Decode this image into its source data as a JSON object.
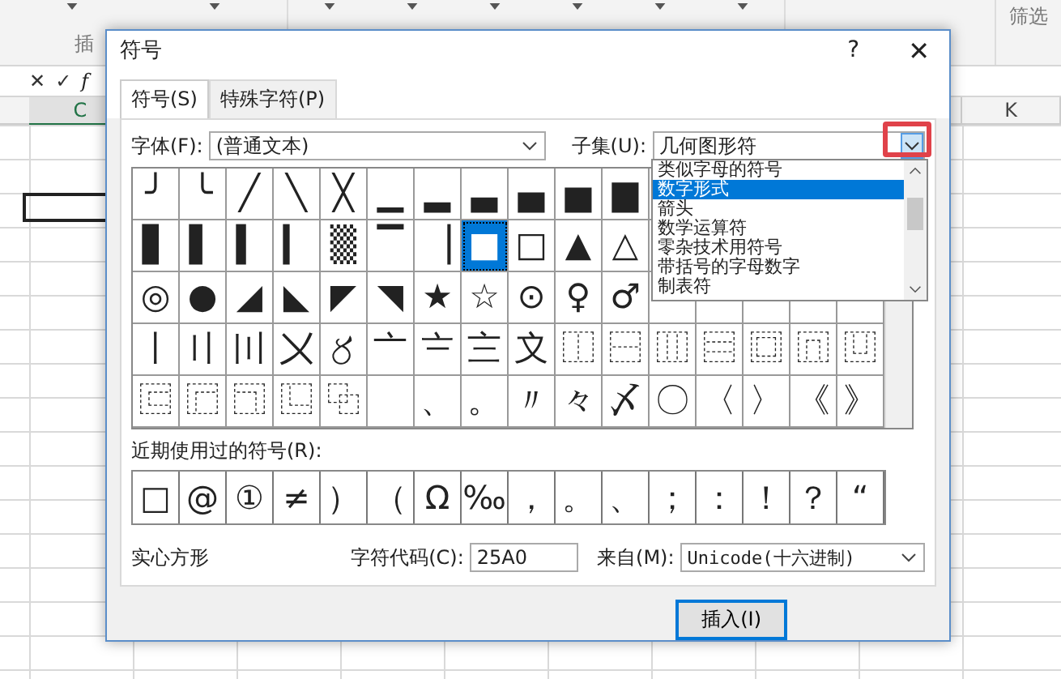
{
  "excel": {
    "ribbon_groups": [
      "插",
      "筛选"
    ],
    "formula_bar": {
      "cancel": "✕",
      "enter": "✓",
      "fx": "f"
    },
    "columns": [
      {
        "label": "C",
        "selected": true
      },
      {
        "label": "K",
        "selected": false
      }
    ]
  },
  "dialog": {
    "title": "符号",
    "help": "?",
    "close": "✕",
    "tabs": [
      {
        "label": "符号(S)",
        "selected": true
      },
      {
        "label": "特殊字符(P)",
        "selected": false
      }
    ],
    "font_label": "字体(F):",
    "font_value": "(普通文本)",
    "subset_label": "子集(U):",
    "subset_value": "几何图形符",
    "subset_list": [
      {
        "label": "类似字母的符号",
        "selected": false
      },
      {
        "label": "数字形式",
        "selected": true
      },
      {
        "label": "箭头",
        "selected": false
      },
      {
        "label": "数学运算符",
        "selected": false
      },
      {
        "label": "零杂技术用符号",
        "selected": false
      },
      {
        "label": "带括号的字母数字",
        "selected": false
      },
      {
        "label": "制表符",
        "selected": false
      }
    ],
    "grid": [
      [
        {
          "char": "╯",
          "selected": false
        },
        {
          "char": "╰",
          "selected": false
        },
        {
          "char": "╱",
          "selected": false
        },
        {
          "char": "╲",
          "selected": false
        },
        {
          "char": "╳",
          "selected": false
        },
        {
          "char": "▁",
          "selected": false
        },
        {
          "char": "▂",
          "selected": false
        },
        {
          "char": "▃",
          "selected": false
        },
        {
          "char": "▄",
          "selected": false
        },
        {
          "char": "▅",
          "selected": false
        },
        {
          "char": "▆",
          "selected": false
        }
      ],
      [
        {
          "char": "▋",
          "selected": false
        },
        {
          "char": "▌",
          "selected": false
        },
        {
          "char": "▍",
          "selected": false
        },
        {
          "char": "▎",
          "selected": false
        },
        {
          "char": "▒",
          "selected": false
        },
        {
          "char": "▔",
          "selected": false
        },
        {
          "char": "▕",
          "selected": false
        },
        {
          "char": "■",
          "selected": true
        },
        {
          "char": "□",
          "selected": false
        },
        {
          "char": "▲",
          "selected": false
        },
        {
          "char": "△",
          "selected": false
        }
      ],
      [
        {
          "char": "◎",
          "selected": false
        },
        {
          "char": "●",
          "selected": false
        },
        {
          "char": "◢",
          "selected": false
        },
        {
          "char": "◣",
          "selected": false
        },
        {
          "char": "◤",
          "selected": false
        },
        {
          "char": "◥",
          "selected": false
        },
        {
          "char": "★",
          "selected": false
        },
        {
          "char": "☆",
          "selected": false
        },
        {
          "char": "⊙",
          "selected": false
        },
        {
          "char": "♀",
          "selected": false
        },
        {
          "char": "♂",
          "selected": false
        }
      ],
      [
        {
          "char": "〡",
          "selected": false
        },
        {
          "char": "〢",
          "selected": false
        },
        {
          "char": "〣",
          "selected": false
        },
        {
          "char": "〤",
          "selected": false
        },
        {
          "char": "〥",
          "selected": false
        },
        {
          "char": "〦",
          "selected": false
        },
        {
          "char": "〧",
          "selected": false
        },
        {
          "char": "〨",
          "selected": false
        },
        {
          "char": "〩",
          "selected": false
        },
        {
          "char": "⿰",
          "selected": false
        },
        {
          "char": "⿱",
          "selected": false
        },
        {
          "char": "⿲",
          "selected": false
        },
        {
          "char": "⿳",
          "selected": false
        },
        {
          "char": "⿴",
          "selected": false
        },
        {
          "char": "⿵",
          "selected": false
        },
        {
          "char": "⿶",
          "selected": false
        }
      ],
      [
        {
          "char": "⿷",
          "selected": false
        },
        {
          "char": "⿸",
          "selected": false
        },
        {
          "char": "⿹",
          "selected": false
        },
        {
          "char": "⿺",
          "selected": false
        },
        {
          "char": "⿻",
          "selected": false
        },
        {
          "selected": false
        },
        {
          "char": "、",
          "selected": false
        },
        {
          "char": "。",
          "selected": false
        },
        {
          "char": "〃",
          "selected": false
        },
        {
          "char": "々",
          "selected": false
        },
        {
          "char": "〆",
          "selected": false
        },
        {
          "char": "〇",
          "selected": false
        },
        {
          "char": "〈",
          "selected": false
        },
        {
          "char": "〉",
          "selected": false
        },
        {
          "char": "《",
          "selected": false
        },
        {
          "char": "》",
          "selected": false
        }
      ]
    ],
    "recent_label": "近期使用过的符号(R):",
    "recent": [
      "□",
      "@",
      "①",
      "≠",
      "）",
      "（",
      "Ω",
      "‰",
      "，",
      "。",
      "、",
      "；",
      "：",
      "！",
      "？",
      "“"
    ],
    "char_name": "实心方形",
    "code_label": "字符代码(C):",
    "code_value": "25A0",
    "from_label": "来自(M):",
    "from_value": "Unicode(十六进制)",
    "insert": "插入(I)"
  }
}
